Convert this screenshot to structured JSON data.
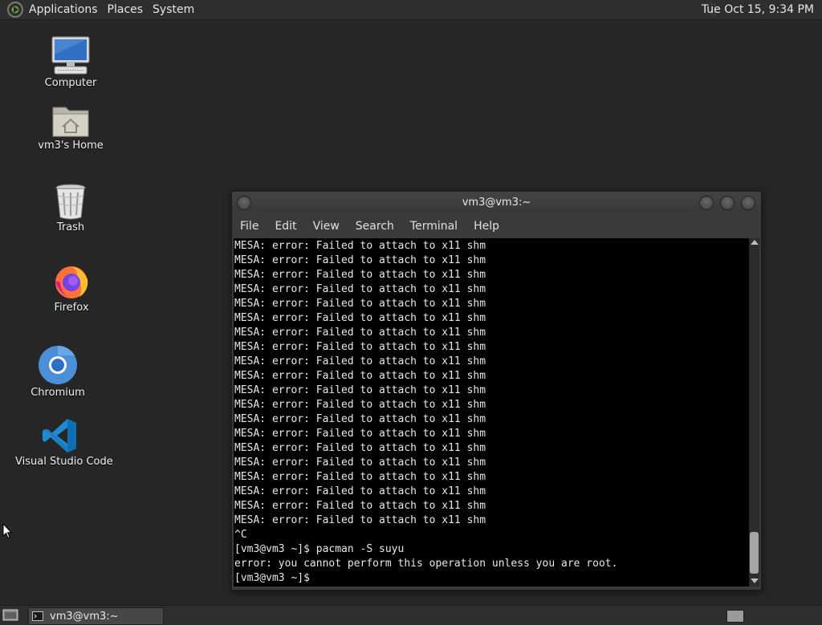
{
  "top_panel": {
    "menus": [
      "Applications",
      "Places",
      "System"
    ],
    "clock": "Tue Oct 15,  9:34 PM"
  },
  "desktop": {
    "icons": [
      {
        "label": "Computer",
        "icon": "computer-icon"
      },
      {
        "label": "vm3's Home",
        "icon": "home-folder-icon"
      },
      {
        "label": "Trash",
        "icon": "trash-icon"
      },
      {
        "label": "Firefox",
        "icon": "firefox-icon"
      },
      {
        "label": "Chromium",
        "icon": "chromium-icon"
      },
      {
        "label": "Visual Studio Code",
        "icon": "vscode-icon"
      }
    ]
  },
  "terminal": {
    "title": "vm3@vm3:~",
    "menu": [
      "File",
      "Edit",
      "View",
      "Search",
      "Terminal",
      "Help"
    ],
    "lines": [
      "MESA: error: Failed to attach to x11 shm",
      "MESA: error: Failed to attach to x11 shm",
      "MESA: error: Failed to attach to x11 shm",
      "MESA: error: Failed to attach to x11 shm",
      "MESA: error: Failed to attach to x11 shm",
      "MESA: error: Failed to attach to x11 shm",
      "MESA: error: Failed to attach to x11 shm",
      "MESA: error: Failed to attach to x11 shm",
      "MESA: error: Failed to attach to x11 shm",
      "MESA: error: Failed to attach to x11 shm",
      "MESA: error: Failed to attach to x11 shm",
      "MESA: error: Failed to attach to x11 shm",
      "MESA: error: Failed to attach to x11 shm",
      "MESA: error: Failed to attach to x11 shm",
      "MESA: error: Failed to attach to x11 shm",
      "MESA: error: Failed to attach to x11 shm",
      "MESA: error: Failed to attach to x11 shm",
      "MESA: error: Failed to attach to x11 shm",
      "MESA: error: Failed to attach to x11 shm",
      "MESA: error: Failed to attach to x11 shm",
      "^C",
      "[vm3@vm3 ~]$ pacman -S suyu",
      "error: you cannot perform this operation unless you are root.",
      "[vm3@vm3 ~]$ "
    ]
  },
  "taskbar": {
    "windows": [
      {
        "label": "vm3@vm3:~",
        "icon": "terminal-icon"
      }
    ]
  },
  "colors": {
    "desktop_bg": "#262626",
    "panel_bg": "#2e2e2e",
    "terminal_bg": "#000000",
    "terminal_fg": "#e8e8e8"
  }
}
